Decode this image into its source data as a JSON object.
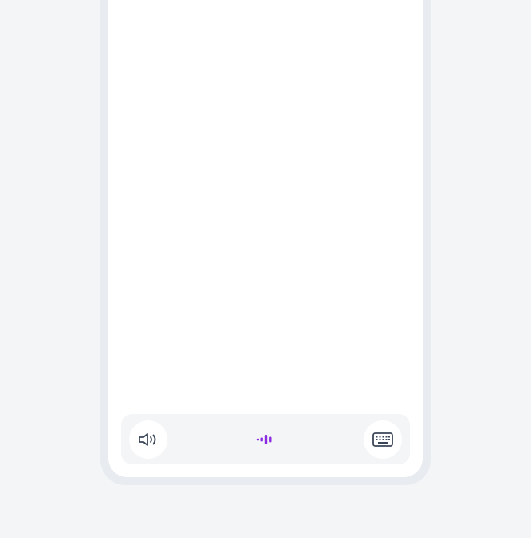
{
  "colors": {
    "page_background": "#f3f5f7",
    "frame": "#e8ecf0",
    "screen": "#ffffff",
    "control_bar": "#f3f5f7",
    "icon_dark": "#3a4657",
    "accent": "#8a2be2"
  },
  "controls": {
    "left": {
      "icon": "speaker-icon"
    },
    "center": {
      "icon": "voice-wave-icon"
    },
    "right": {
      "icon": "keyboard-icon"
    }
  }
}
